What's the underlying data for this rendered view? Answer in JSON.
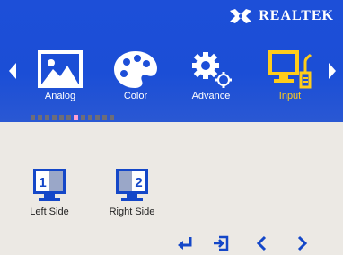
{
  "brand": {
    "name": "REALTEK"
  },
  "menu": {
    "items": [
      {
        "label": "Analog",
        "icon": "picture-icon"
      },
      {
        "label": "Color",
        "icon": "palette-icon"
      },
      {
        "label": "Advance",
        "icon": "gears-icon"
      },
      {
        "label": "Input",
        "icon": "monitor-icon",
        "active": true
      }
    ],
    "page_dots": 12,
    "active_dot_index": 6
  },
  "options": [
    {
      "label": "Left Side",
      "number": "1"
    },
    {
      "label": "Right Side",
      "number": "2"
    }
  ],
  "controls": [
    {
      "name": "enter",
      "icon": "enter-icon"
    },
    {
      "name": "exit",
      "icon": "exit-icon"
    },
    {
      "name": "left",
      "icon": "chevron-left-icon"
    },
    {
      "name": "right",
      "icon": "chevron-right-icon"
    }
  ],
  "colors": {
    "top_bg": "#1d4fd8",
    "bottom_bg": "#ece9e4",
    "active_label": "#ffcc1a",
    "icon_blue": "#1447c8",
    "dot_active": "#ff9fd2"
  }
}
